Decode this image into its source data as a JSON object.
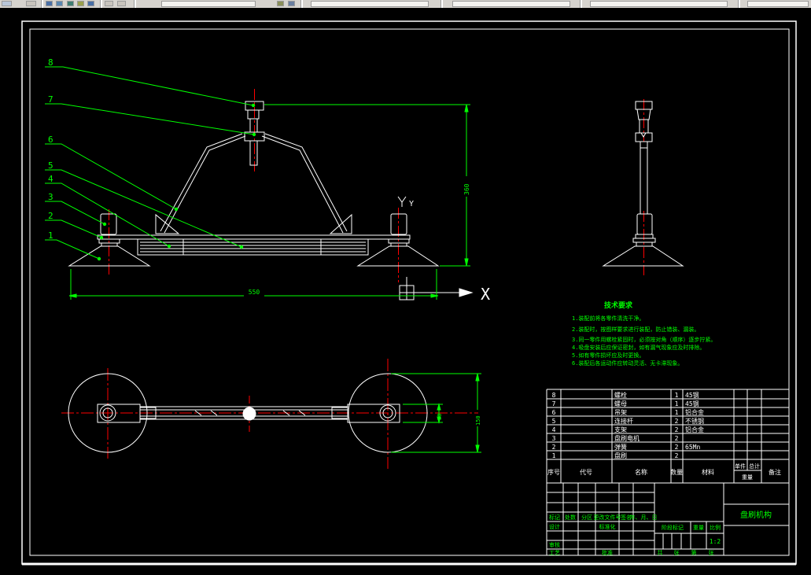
{
  "colors": {
    "background": "#000000",
    "geometry": "#ffffff",
    "centerline": "#ff0000",
    "annotation": "#00ff00",
    "toolbar_bg": "#d6d3ce"
  },
  "axes": {
    "x_label": "X",
    "y_label": "Y"
  },
  "callouts": {
    "c1": "1",
    "c2": "2",
    "c3": "3",
    "c4": "4",
    "c5": "5",
    "c6": "6",
    "c7": "7",
    "c8": "8"
  },
  "dimensions": {
    "overall_width": "550",
    "overall_height": "360",
    "pad_width": "50",
    "pad_diameter": "150"
  },
  "tech_req": {
    "title": "技术要求",
    "items": [
      "1.装配前将各零件清洗干净。",
      "2.装配时，按图样要求进行装配，防止错装、漏装。",
      "3.同一零件用螺栓紧固时，必须按对角（顺序）逐步拧紧。",
      "4.吸盘安装后应保证密封，如有漏气现象应及时排除。",
      "5.如有零件损坏应及时更换。",
      "6.装配后各运动件应转动灵活、无卡滞现象。"
    ]
  },
  "bom": {
    "headers": {
      "no": "序号",
      "code": "代号",
      "name": "名称",
      "qty": "数量",
      "material": "材料",
      "unit": "单件",
      "total": "总计",
      "weight": "重量",
      "remark": "备注"
    },
    "rows": [
      {
        "no": "8",
        "code": "",
        "name": "螺栓",
        "qty": "1",
        "material": "45钢",
        "remark": ""
      },
      {
        "no": "7",
        "code": "",
        "name": "螺母",
        "qty": "1",
        "material": "45钢",
        "remark": ""
      },
      {
        "no": "6",
        "code": "",
        "name": "吊架",
        "qty": "1",
        "material": "铝合金",
        "remark": ""
      },
      {
        "no": "5",
        "code": "",
        "name": "连接杆",
        "qty": "2",
        "material": "不锈钢",
        "remark": ""
      },
      {
        "no": "4",
        "code": "",
        "name": "支架",
        "qty": "2",
        "material": "铝合金",
        "remark": ""
      },
      {
        "no": "3",
        "code": "",
        "name": "盘刷电机",
        "qty": "2",
        "material": "",
        "remark": ""
      },
      {
        "no": "2",
        "code": "",
        "name": "弹簧",
        "qty": "2",
        "material": "65Mn",
        "remark": ""
      },
      {
        "no": "1",
        "code": "",
        "name": "盘刷",
        "qty": "2",
        "material": "",
        "remark": ""
      }
    ]
  },
  "title_block": {
    "drawing_title": "盘刷机构",
    "scale_value": "1:2",
    "labels": {
      "mark": "标记",
      "count": "处数",
      "zone": "分区",
      "change_doc": "更改文件号",
      "sign": "签名",
      "date": "年、月、日",
      "design": "设计",
      "standardize": "标准化",
      "check": "审核",
      "process": "工艺",
      "approve": "批准",
      "stage_mark": "阶段标记",
      "weight": "重量",
      "scale": "比例",
      "sheet_total_prefix": "共",
      "sheet_total_suffix": "张",
      "sheet_no_prefix": "第",
      "sheet_no_suffix": "张"
    }
  }
}
